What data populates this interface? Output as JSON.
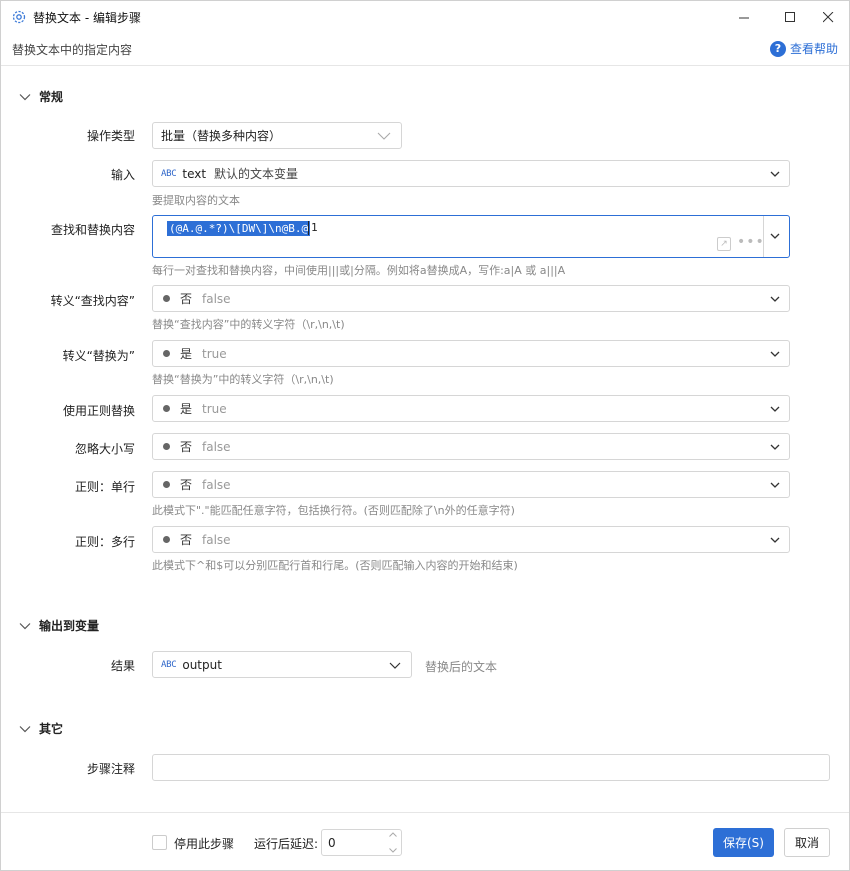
{
  "window": {
    "title": "替换文本 - 编辑步骤",
    "subtitle": "替换文本中的指定内容",
    "help_label": "查看帮助",
    "help_glyph": "?"
  },
  "sections": {
    "general": "常规",
    "output": "输出到变量",
    "other": "其它"
  },
  "fields": {
    "op_type": {
      "label": "操作类型",
      "value": "批量（替换多种内容）"
    },
    "input": {
      "label": "输入",
      "icon_text": "ABC",
      "var_name": "text",
      "var_desc": "默认的文本变量",
      "hint": "要提取内容的文本"
    },
    "find_replace": {
      "label": "查找和替换内容",
      "selected_text": "(@A.@.*?)\\[DW\\]\\n@B.@",
      "tail_text": "1",
      "ext_glyph": "↗",
      "more_glyph": "•••",
      "hint": "每行一对查找和替换内容，中间使用|||或|分隔。例如将a替换成A，写作:a|A 或 a|||A"
    },
    "escape_find": {
      "label": "转义“查找内容”",
      "value": "否",
      "sub": "false",
      "hint": "替换“查找内容”中的转义字符（\\r,\\n,\\t)"
    },
    "escape_replace": {
      "label": "转义“替换为”",
      "value": "是",
      "sub": "true",
      "hint": "替换“替换为”中的转义字符（\\r,\\n,\\t)"
    },
    "use_regex": {
      "label": "使用正则替换",
      "value": "是",
      "sub": "true"
    },
    "ignore_case": {
      "label": "忽略大小写",
      "value": "否",
      "sub": "false"
    },
    "single_line": {
      "label": "正则：单行",
      "value": "否",
      "sub": "false",
      "hint": "此模式下\".\"能匹配任意字符，包括换行符。(否则匹配除了\\n外的任意字符)"
    },
    "multi_line": {
      "label": "正则：多行",
      "value": "否",
      "sub": "false",
      "hint": "此模式下^和$可以分别匹配行首和行尾。(否则匹配输入内容的开始和结束)"
    },
    "result": {
      "label": "结果",
      "icon_text": "ABC",
      "var_name": "output",
      "desc": "替换后的文本"
    },
    "note": {
      "label": "步骤注释",
      "value": ""
    }
  },
  "footer": {
    "disable_label": "停用此步骤",
    "delay_label": "运行后延迟:",
    "delay_value": "0",
    "save_label": "保存(S)",
    "cancel_label": "取消"
  },
  "colors": {
    "accent": "#2d6fd6",
    "border": "#d6d6d6",
    "hint": "#888888"
  }
}
